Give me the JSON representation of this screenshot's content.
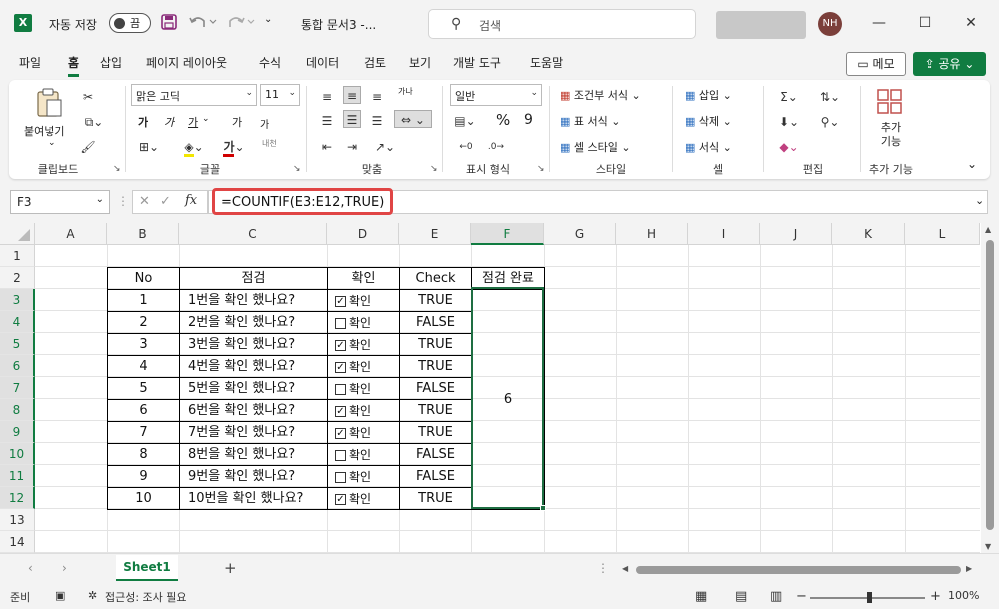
{
  "titlebar": {
    "logo": "X",
    "autosave_label": "자동 저장",
    "autosave_state": "끔",
    "save_icon": "save-icon",
    "undo_icon": "undo-icon",
    "redo_icon": "redo-icon",
    "doc_title": "통합 문서3  -...",
    "search_placeholder": "검색",
    "avatar_initials": "NH",
    "minimize": "—",
    "maximize": "☐",
    "close": "✕"
  },
  "menu": {
    "items": [
      "파일",
      "홈",
      "삽입",
      "페이지 레이아웃",
      "수식",
      "데이터",
      "검토",
      "보기",
      "개발 도구",
      "도움말"
    ],
    "active": "홈",
    "memo_label": "메모",
    "share_label": "공유"
  },
  "ribbon": {
    "clipboard": {
      "paste_label": "붙여넣기",
      "group_label": "클립보드"
    },
    "font": {
      "font_name": "맑은 고딕",
      "font_size": "11",
      "group_label": "글꼴",
      "bold": "가",
      "italic": "가",
      "underline": "가",
      "grow": "가",
      "shrink": "가",
      "phonetic": "내천"
    },
    "alignment": {
      "group_label": "맞춤",
      "wrap": "가나"
    },
    "number": {
      "format": "일반",
      "group_label": "표시 형식",
      "percent": "%",
      "comma": "9"
    },
    "styles": {
      "conditional": "조건부 서식",
      "table": "표 서식",
      "cell_style": "셀 스타일",
      "group_label": "스타일"
    },
    "cells": {
      "insert": "삽입",
      "delete": "삭제",
      "format": "서식",
      "group_label": "셀"
    },
    "editing": {
      "group_label": "편집"
    },
    "addins": {
      "label": "추가\n기능",
      "group_label": "추가 기능"
    }
  },
  "formula_bar": {
    "name_box": "F3",
    "cancel": "✕",
    "enter": "✓",
    "fx": "fx",
    "formula": "=COUNTIF(E3:E12,TRUE)"
  },
  "grid": {
    "columns": [
      "A",
      "B",
      "C",
      "D",
      "E",
      "F",
      "G",
      "H",
      "I",
      "J",
      "K",
      "L"
    ],
    "selected_column": "F",
    "rows": [
      "1",
      "2",
      "3",
      "4",
      "5",
      "6",
      "7",
      "8",
      "9",
      "10",
      "11",
      "12",
      "13",
      "14"
    ],
    "table_headers": {
      "no": "No",
      "check_item": "점검",
      "confirm": "확인",
      "check": "Check",
      "done": "점검 완료"
    },
    "records": [
      {
        "no": "1",
        "item": "1번을 확인 했나요?",
        "checked": true,
        "label": "확인",
        "value": "TRUE"
      },
      {
        "no": "2",
        "item": "2번을 확인 했나요?",
        "checked": false,
        "label": "확인",
        "value": "FALSE"
      },
      {
        "no": "3",
        "item": "3번을 확인 했나요?",
        "checked": true,
        "label": "확인",
        "value": "TRUE"
      },
      {
        "no": "4",
        "item": "4번을 확인 했나요?",
        "checked": true,
        "label": "확인",
        "value": "TRUE"
      },
      {
        "no": "5",
        "item": "5번을 확인 했나요?",
        "checked": false,
        "label": "확인",
        "value": "FALSE"
      },
      {
        "no": "6",
        "item": "6번을 확인 했나요?",
        "checked": true,
        "label": "확인",
        "value": "TRUE"
      },
      {
        "no": "7",
        "item": "7번을 확인 했나요?",
        "checked": true,
        "label": "확인",
        "value": "TRUE"
      },
      {
        "no": "8",
        "item": "8번을 확인 했나요?",
        "checked": false,
        "label": "확인",
        "value": "FALSE"
      },
      {
        "no": "9",
        "item": "9번을 확인 했나요?",
        "checked": false,
        "label": "확인",
        "value": "FALSE"
      },
      {
        "no": "10",
        "item": "10번을 확인 했나요?",
        "checked": true,
        "label": "확인",
        "value": "TRUE"
      }
    ],
    "merged_result": "6"
  },
  "sheet_tabs": {
    "active": "Sheet1",
    "add": "+"
  },
  "status": {
    "ready": "준비",
    "accessibility": "접근성: 조사 필요",
    "zoom": "100%",
    "zoom_out": "−",
    "zoom_in": "+"
  },
  "colors": {
    "accent": "#107c41",
    "highlight_border": "#e04545"
  }
}
